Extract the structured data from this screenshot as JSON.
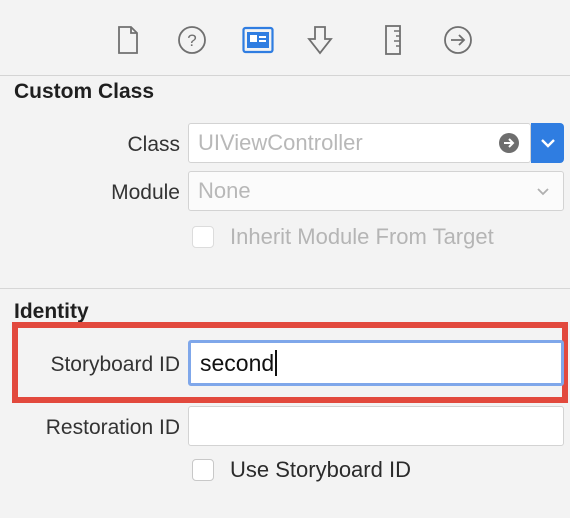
{
  "toolbar": {
    "icons": [
      "file-icon",
      "help-icon",
      "identity-icon",
      "attributes-icon",
      "size-icon",
      "connections-icon"
    ],
    "active_color": "#2f7de1"
  },
  "custom_class": {
    "title": "Custom Class",
    "class_label": "Class",
    "class_placeholder": "UIViewController",
    "module_label": "Module",
    "module_placeholder": "None",
    "inherit_label": "Inherit Module From Target"
  },
  "identity": {
    "title": "Identity",
    "storyboard_id_label": "Storyboard ID",
    "storyboard_id_value": "second",
    "restoration_id_label": "Restoration ID",
    "restoration_id_value": "",
    "use_storyboard_id_label": "Use Storyboard ID",
    "highlight_color": "#e2493d"
  }
}
